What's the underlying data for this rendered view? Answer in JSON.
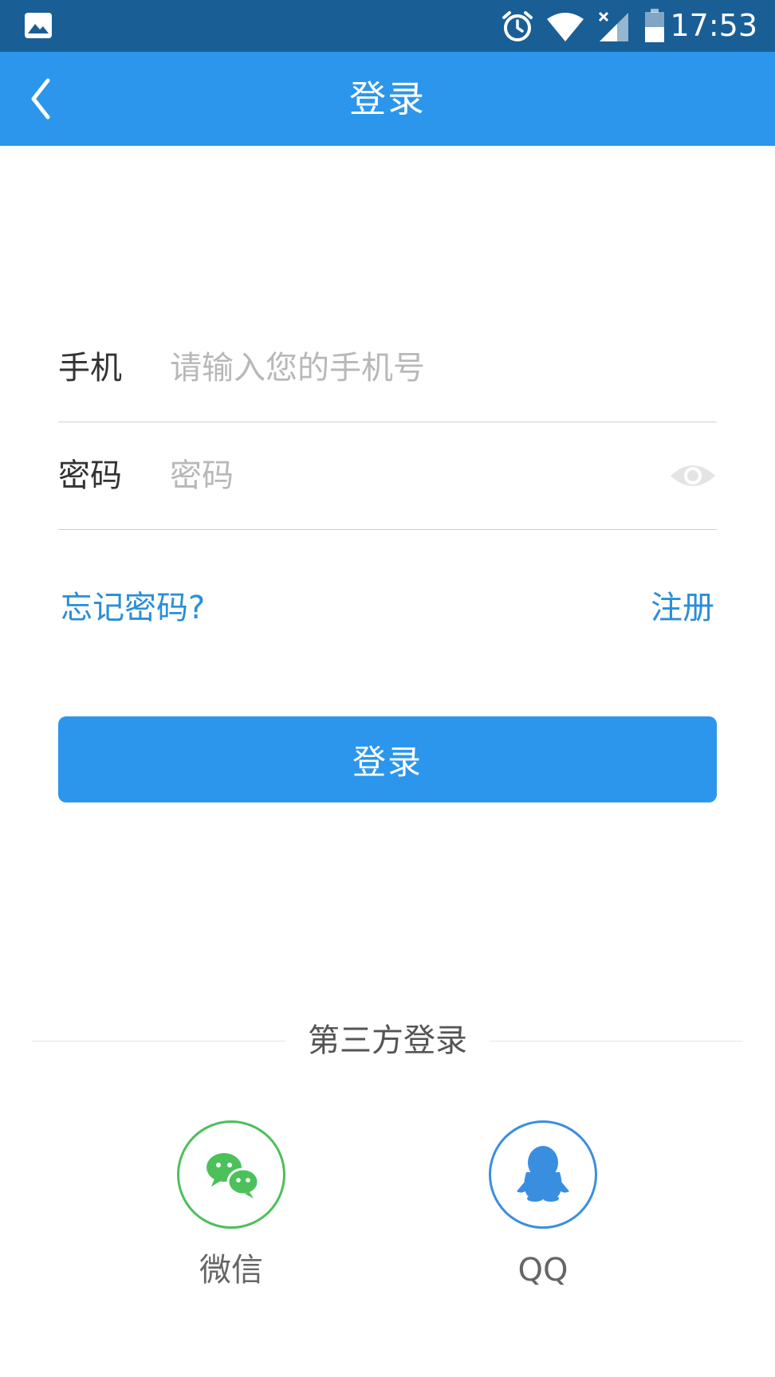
{
  "status_bar": {
    "time": "17:53",
    "icons": [
      "gallery-icon",
      "alarm-icon",
      "wifi-icon",
      "signal-icon",
      "battery-icon"
    ]
  },
  "app_bar": {
    "title": "登录",
    "back_icon": "back-arrow-icon"
  },
  "form": {
    "phone": {
      "label": "手机",
      "placeholder": "请输入您的手机号"
    },
    "password": {
      "label": "密码",
      "placeholder": "密码",
      "visibility_icon": "eye-icon"
    }
  },
  "links": {
    "forgot_password": "忘记密码?",
    "register": "注册"
  },
  "login_button": {
    "label": "登录"
  },
  "third_party": {
    "title": "第三方登录",
    "options": [
      {
        "label": "微信",
        "icon": "wechat-icon"
      },
      {
        "label": "QQ",
        "icon": "qq-icon"
      }
    ]
  },
  "colors": {
    "status_bar": "#1a5e96",
    "primary": "#2b96ec",
    "link": "#2b8ed6",
    "wechat": "#4cc05a",
    "qq": "#3a8ee0"
  }
}
